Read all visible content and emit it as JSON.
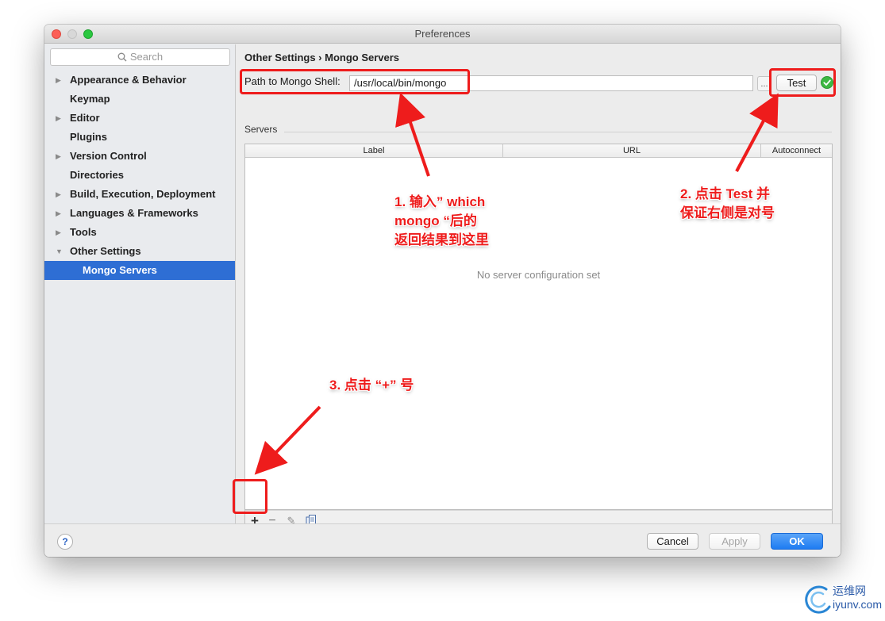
{
  "window": {
    "title": "Preferences"
  },
  "sidebar": {
    "search_placeholder": "Search",
    "items": [
      {
        "label": "Appearance & Behavior",
        "expandable": true
      },
      {
        "label": "Keymap",
        "expandable": false
      },
      {
        "label": "Editor",
        "expandable": true
      },
      {
        "label": "Plugins",
        "expandable": false
      },
      {
        "label": "Version Control",
        "expandable": true
      },
      {
        "label": "Directories",
        "expandable": false
      },
      {
        "label": "Build, Execution, Deployment",
        "expandable": true
      },
      {
        "label": "Languages & Frameworks",
        "expandable": true
      },
      {
        "label": "Tools",
        "expandable": true
      },
      {
        "label": "Other Settings",
        "expanded": true
      },
      {
        "label": "Mongo Servers",
        "selected": true
      }
    ]
  },
  "main": {
    "breadcrumb": "Other Settings › Mongo Servers",
    "path_label": "Path to Mongo Shell:",
    "path_value": "/usr/local/bin/mongo",
    "browse_label": "...",
    "test_label": "Test",
    "servers_label": "Servers",
    "table": {
      "columns": [
        "Label",
        "URL",
        "Autoconnect"
      ],
      "empty_text": "No server configuration set"
    },
    "toolbar": {
      "add": "+",
      "remove": "−",
      "edit": "✎"
    }
  },
  "footer": {
    "help_label": "?",
    "cancel_label": "Cancel",
    "apply_label": "Apply",
    "ok_label": "OK"
  },
  "annotations": {
    "note1": [
      "1. 输入” which",
      "mongo “后的",
      "返回结果到这里"
    ],
    "note2": [
      "2. 点击 Test 并",
      "保证右侧是对号"
    ],
    "note3": "3. 点击 “+” 号"
  },
  "watermark": {
    "name": "运维网",
    "url": "iyunv.com"
  },
  "colors": {
    "accent": "#2e6ed4",
    "annotation": "#ee1c1c",
    "success": "#3db843",
    "close": "#fc5f57",
    "maximize": "#2bc840"
  }
}
